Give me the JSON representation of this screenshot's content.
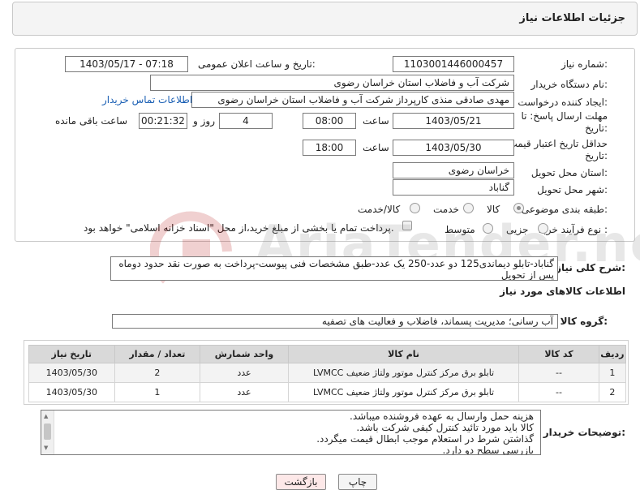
{
  "header": {
    "title": "جزئیات اطلاعات نیاز"
  },
  "form": {
    "need_number": {
      "label": "شماره نیاز:",
      "value": "1103001446000457"
    },
    "announce_datetime": {
      "label": "تاریخ و ساعت اعلان عمومی:",
      "value": "1403/05/17 - 07:18"
    },
    "buyer_org": {
      "label": "نام دستگاه خریدار:",
      "value": "شرکت آب و فاضلاب استان خراسان رضوی"
    },
    "requester": {
      "label": "ایجاد کننده درخواست:",
      "value": "مهدی صادقی منذی کارپرداز شرکت آب و فاضلاب استان خراسان رضوی",
      "contact_link": "اطلاعات تماس خریدار"
    },
    "deadline": {
      "label": "مهلت ارسال پاسخ: تا تاریخ:",
      "date": "1403/05/21",
      "time_label": "ساعت",
      "time": "08:00",
      "days": "4",
      "days_label": "روز و",
      "remaining": "00:21:32",
      "remaining_label": "ساعت باقی مانده"
    },
    "price_validity": {
      "label": "حداقل تاریخ اعتبار قیمت: تا تاریخ:",
      "date": "1403/05/30",
      "time_label": "ساعت",
      "time": "18:00"
    },
    "delivery_province": {
      "label": "استان محل تحویل:",
      "value": "خراسان رضوی"
    },
    "delivery_city": {
      "label": "شهر محل تحویل:",
      "value": "گناباد"
    },
    "category": {
      "label": "طبقه بندی موضوعی:",
      "options": [
        "کالا",
        "خدمت",
        "کالا/خدمت"
      ],
      "selected": "کالا"
    },
    "process_type": {
      "label": "نوع فرآیند خرید :",
      "options": [
        "جزیی",
        "متوسط"
      ],
      "note": "پرداخت تمام یا بخشی از مبلغ خرید،از محل \"اسناد خزانه اسلامی\" خواهد بود."
    }
  },
  "description": {
    "label": "شرح کلی نیاز:",
    "value": "گناباد-تابلو دیماندی125 دو عدد-250 یک عدد-طبق مشخصات فنی پیوست-پرداخت به صورت نقد حدود دوماه پس از تحویل"
  },
  "goods_info_title": "اطلاعات کالاهای مورد نیاز",
  "goods_group": {
    "label": "گروه کالا:",
    "value": "آب رسانی؛ مدیریت پسماند، فاضلاب و فعالیت های تصفیه"
  },
  "table": {
    "headers": [
      "ردیف",
      "کد کالا",
      "نام کالا",
      "واحد شمارش",
      "تعداد / مقدار",
      "تاریخ نیاز"
    ],
    "rows": [
      {
        "row": "1",
        "code": "--",
        "name": "تابلو برق مرکز کنترل موتور ولتاژ ضعیف LVMCC",
        "unit": "عدد",
        "qty": "2",
        "date": "1403/05/30"
      },
      {
        "row": "2",
        "code": "--",
        "name": "تابلو برق مرکز کنترل موتور ولتاژ ضعیف LVMCC",
        "unit": "عدد",
        "qty": "1",
        "date": "1403/05/30"
      }
    ]
  },
  "buyer_notes": {
    "label": "توضیحات خریدار:",
    "lines": [
      "هزینه حمل وارسال به عهده فروشنده میباشد.",
      "کالا باید مورد تائید کنترل کیفی شرکت باشد.",
      "گذاشتن شرط در استعلام موجب ابطال قیمت میگردد.",
      "بازرسی سطح دو دارد."
    ]
  },
  "buttons": {
    "print": "چاپ",
    "back": "بازگشت"
  },
  "watermark": {
    "text": "AriaTender.net"
  },
  "colors": {
    "link": "#1a5fb4",
    "back_button_bg": "#fde8e8",
    "header_bg": "#f4f4f4",
    "table_header_bg": "#d9d9d9"
  }
}
